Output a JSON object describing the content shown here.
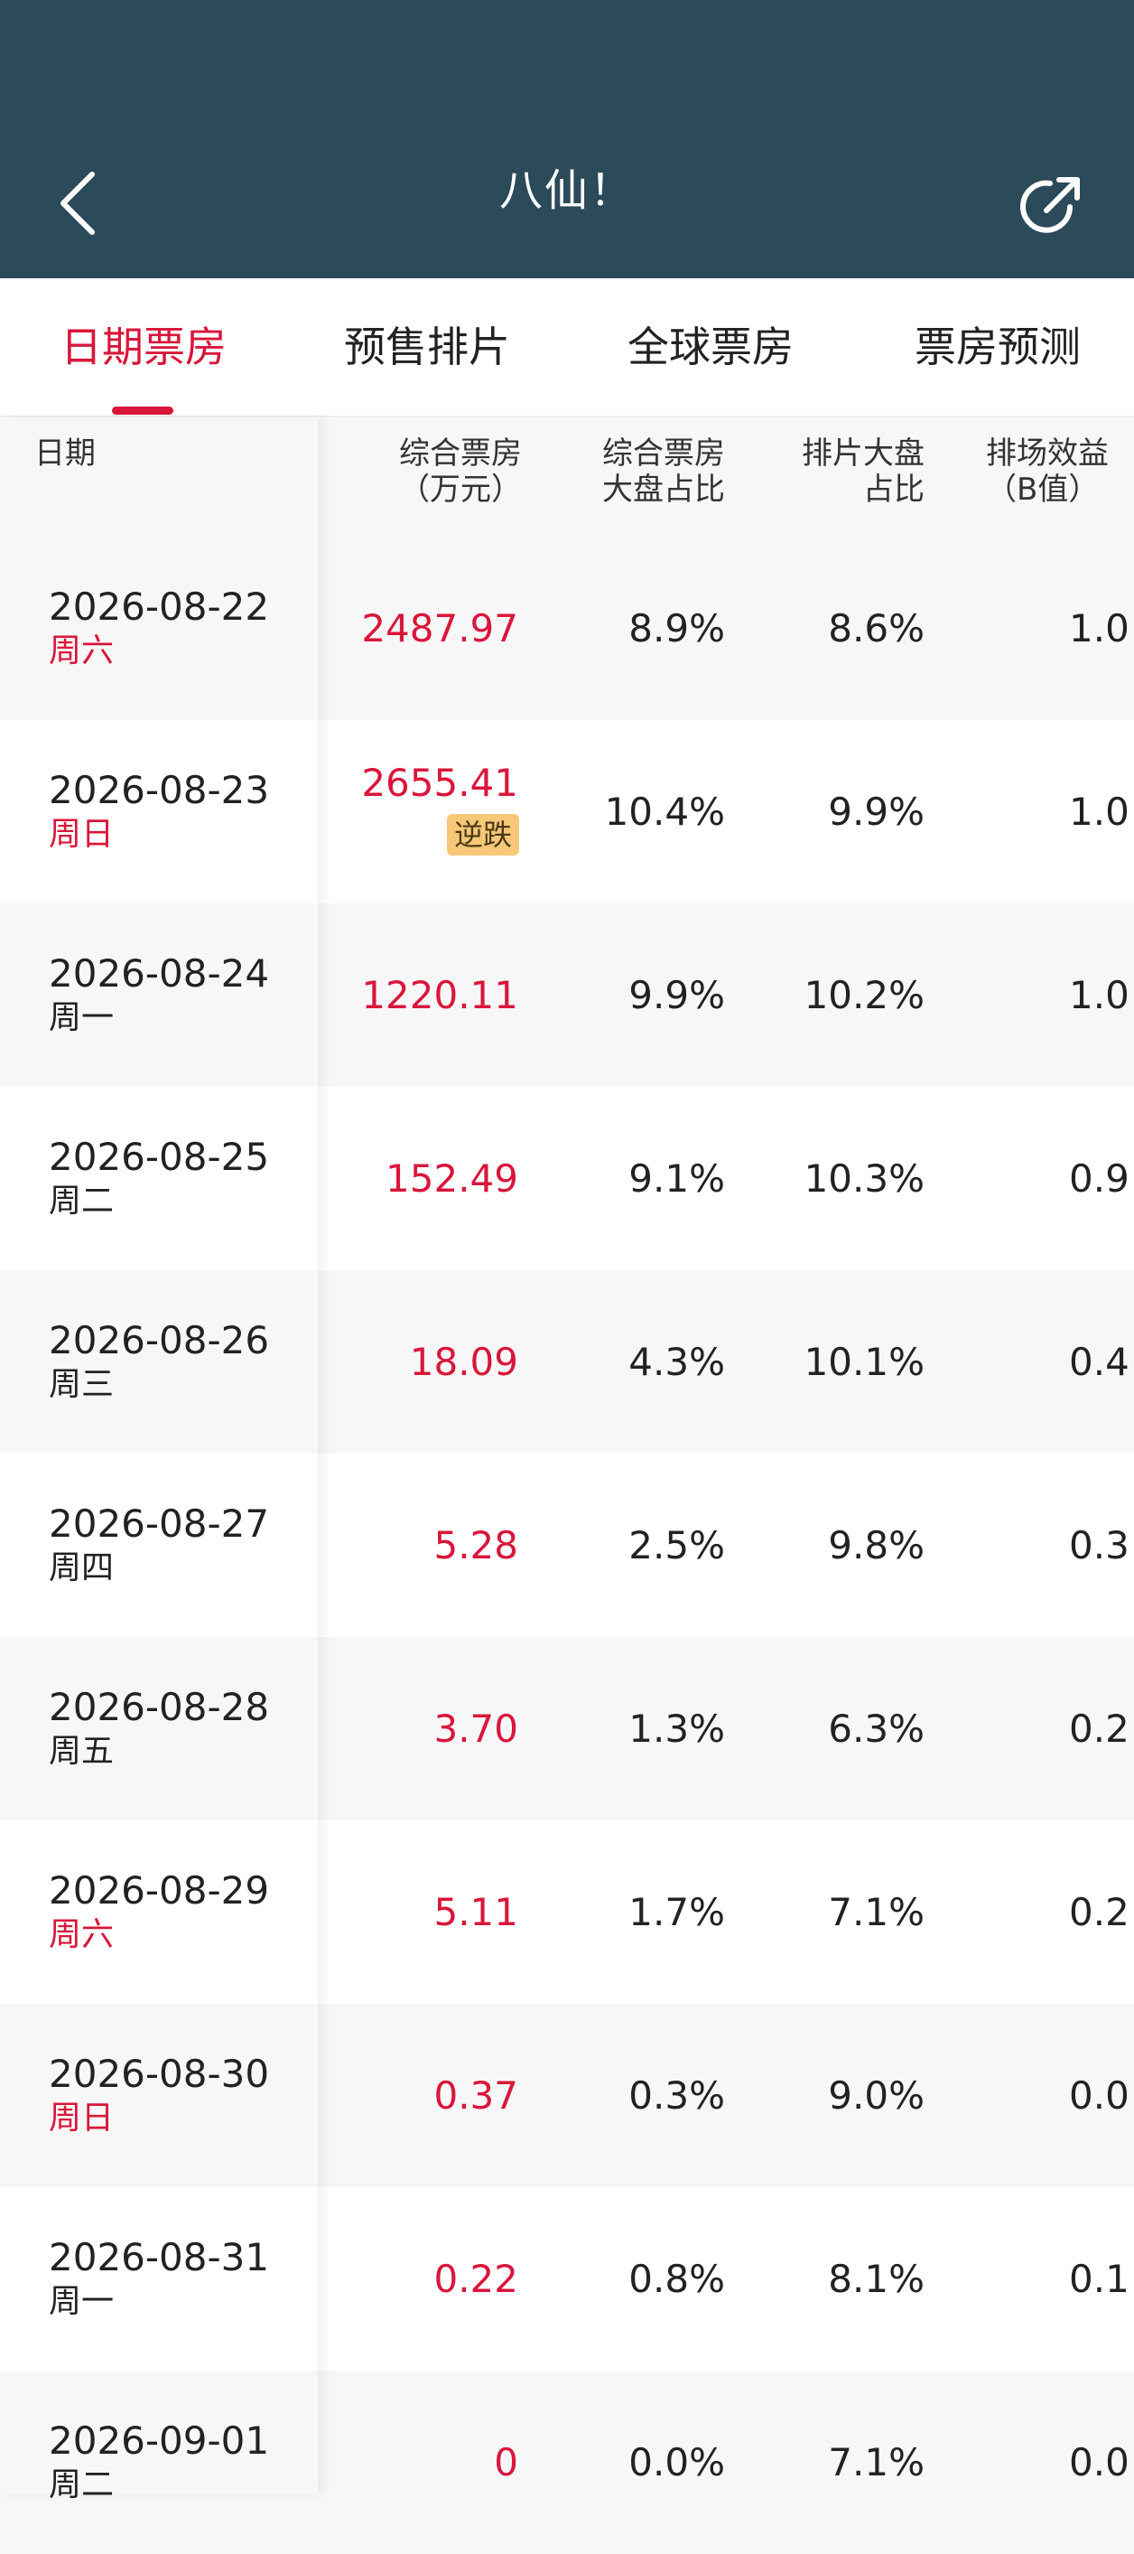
{
  "header": {
    "title": "八仙！",
    "back_icon": "chevron-left-icon",
    "share_icon": "share-icon",
    "bg_color": "#2b4a5a"
  },
  "tabs": [
    {
      "label": "日期票房",
      "active": true
    },
    {
      "label": "预售排片",
      "active": false
    },
    {
      "label": "全球票房",
      "active": false
    },
    {
      "label": "票房预测",
      "active": false
    }
  ],
  "accent_color": "#d9163a",
  "columns": {
    "date": "日期",
    "box_line1": "综合票房",
    "box_line2": "（万元）",
    "boxshare_line1": "综合票房",
    "boxshare_line2": "大盘占比",
    "sched_line1": "排片大盘",
    "sched_line2": "占比",
    "eff_line1": "排场效益",
    "eff_line2": "（B值）"
  },
  "rows": [
    {
      "date": "2026-08-22",
      "weekday": "周六",
      "weekend": true,
      "box": "2487.97",
      "badge": "",
      "box_share": "8.9%",
      "sched_share": "8.6%",
      "eff": "1.0"
    },
    {
      "date": "2026-08-23",
      "weekday": "周日",
      "weekend": true,
      "box": "2655.41",
      "badge": "逆跌",
      "box_share": "10.4%",
      "sched_share": "9.9%",
      "eff": "1.0"
    },
    {
      "date": "2026-08-24",
      "weekday": "周一",
      "weekend": false,
      "box": "1220.11",
      "badge": "",
      "box_share": "9.9%",
      "sched_share": "10.2%",
      "eff": "1.0"
    },
    {
      "date": "2026-08-25",
      "weekday": "周二",
      "weekend": false,
      "box": "152.49",
      "badge": "",
      "box_share": "9.1%",
      "sched_share": "10.3%",
      "eff": "0.9"
    },
    {
      "date": "2026-08-26",
      "weekday": "周三",
      "weekend": false,
      "box": "18.09",
      "badge": "",
      "box_share": "4.3%",
      "sched_share": "10.1%",
      "eff": "0.4"
    },
    {
      "date": "2026-08-27",
      "weekday": "周四",
      "weekend": false,
      "box": "5.28",
      "badge": "",
      "box_share": "2.5%",
      "sched_share": "9.8%",
      "eff": "0.3"
    },
    {
      "date": "2026-08-28",
      "weekday": "周五",
      "weekend": false,
      "box": "3.70",
      "badge": "",
      "box_share": "1.3%",
      "sched_share": "6.3%",
      "eff": "0.2"
    },
    {
      "date": "2026-08-29",
      "weekday": "周六",
      "weekend": true,
      "box": "5.11",
      "badge": "",
      "box_share": "1.7%",
      "sched_share": "7.1%",
      "eff": "0.2"
    },
    {
      "date": "2026-08-30",
      "weekday": "周日",
      "weekend": true,
      "box": "0.37",
      "badge": "",
      "box_share": "0.3%",
      "sched_share": "9.0%",
      "eff": "0.0"
    },
    {
      "date": "2026-08-31",
      "weekday": "周一",
      "weekend": false,
      "box": "0.22",
      "badge": "",
      "box_share": "0.8%",
      "sched_share": "8.1%",
      "eff": "0.1"
    },
    {
      "date": "2026-09-01",
      "weekday": "周二",
      "weekend": false,
      "box": "0",
      "badge": "",
      "box_share": "0.0%",
      "sched_share": "7.1%",
      "eff": "0.0"
    }
  ]
}
